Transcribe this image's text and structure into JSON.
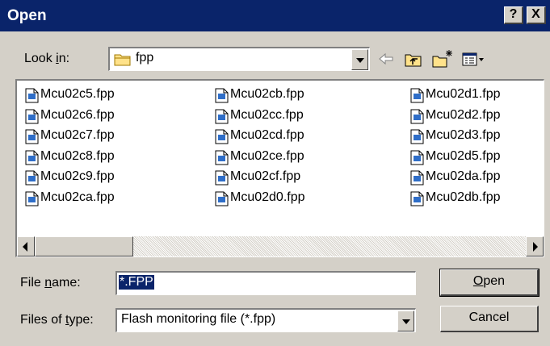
{
  "window": {
    "title": "Open",
    "help_glyph": "?",
    "close_glyph": "X"
  },
  "lookin": {
    "label_pre": "Look ",
    "label_key": "i",
    "label_post": "n:",
    "folder_icon": "folder-icon",
    "value": "fpp"
  },
  "toolbar": {
    "icons": [
      "back-arrow-icon",
      "up-folder-icon",
      "new-folder-icon",
      "view-menu-icon"
    ]
  },
  "files": {
    "columns": [
      [
        "Mcu02c5.fpp",
        "Mcu02c6.fpp",
        "Mcu02c7.fpp",
        "Mcu02c8.fpp",
        "Mcu02c9.fpp",
        "Mcu02ca.fpp"
      ],
      [
        "Mcu02cb.fpp",
        "Mcu02cc.fpp",
        "Mcu02cd.fpp",
        "Mcu02ce.fpp",
        "Mcu02cf.fpp",
        "Mcu02d0.fpp"
      ],
      [
        "Mcu02d1.fpp",
        "Mcu02d2.fpp",
        "Mcu02d3.fpp",
        "Mcu02d5.fpp",
        "Mcu02da.fpp",
        "Mcu02db.fpp"
      ]
    ]
  },
  "filename": {
    "label_pre": "File ",
    "label_key": "n",
    "label_post": "ame:",
    "value": "*.FPP"
  },
  "filetype": {
    "label_pre": "Files of ",
    "label_key": "t",
    "label_post": "ype:",
    "value": "Flash monitoring file (*.fpp)"
  },
  "buttons": {
    "open_key": "O",
    "open_rest": "pen",
    "cancel": "Cancel"
  },
  "colors": {
    "titlebar": "#0a246a",
    "face": "#d4d0c8",
    "selection": "#0a246a"
  }
}
